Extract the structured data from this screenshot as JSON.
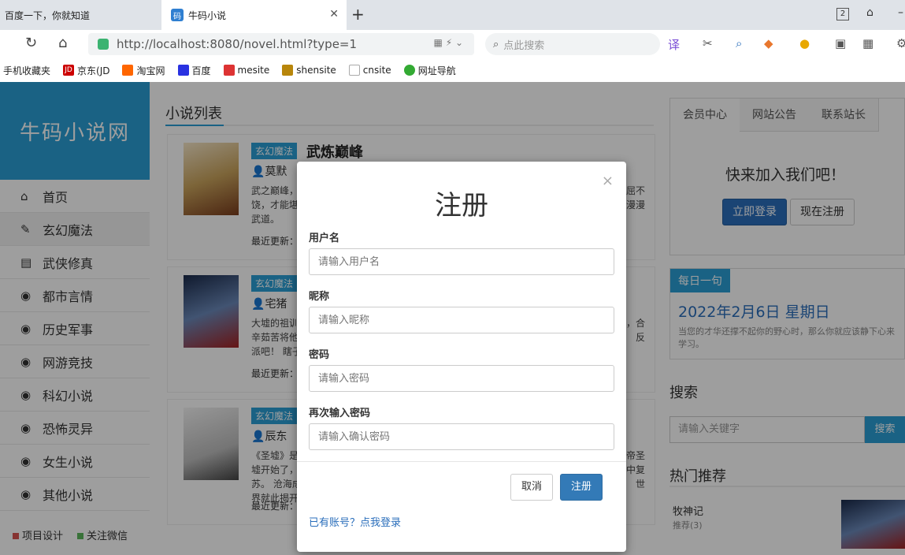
{
  "browser": {
    "tabs": [
      {
        "label": "百度一下，你就知道"
      },
      {
        "label": "牛码小说",
        "favicon": "码"
      }
    ],
    "tab_count": "2",
    "url": "http://localhost:8080/novel.html?type=1",
    "search_placeholder": "点此搜索",
    "bookmarks": [
      {
        "label": "手机收藏夹"
      },
      {
        "label": "京东(JD",
        "icon": "JD"
      },
      {
        "label": "淘宝网"
      },
      {
        "label": "百度"
      },
      {
        "label": "mesite"
      },
      {
        "label": "shensite"
      },
      {
        "label": "cnsite"
      },
      {
        "label": "网址导航"
      }
    ]
  },
  "site": {
    "logo": "牛码小说网",
    "nav": [
      {
        "label": "首页",
        "icon": "home-icon"
      },
      {
        "label": "玄幻魔法",
        "icon": "magic-icon"
      },
      {
        "label": "武侠修真",
        "icon": "book-icon"
      },
      {
        "label": "都市言情",
        "icon": "globe-icon"
      },
      {
        "label": "历史军事",
        "icon": "globe-icon"
      },
      {
        "label": "网游竞技",
        "icon": "globe-icon"
      },
      {
        "label": "科幻小说",
        "icon": "globe-icon"
      },
      {
        "label": "恐怖灵异",
        "icon": "globe-icon"
      },
      {
        "label": "女生小说",
        "icon": "globe-icon"
      },
      {
        "label": "其他小说",
        "icon": "globe-icon"
      }
    ],
    "footer": [
      {
        "label": "项目设计",
        "color": "#d9534f"
      },
      {
        "label": "关注微信",
        "color": "#5cb85c"
      }
    ],
    "list_title": "小说列表",
    "update_label": "最近更新：",
    "novels": [
      {
        "tag": "玄幻魔法",
        "title": "武炼巅峰",
        "author": "莫默",
        "desc": "武之巅峰，",
        "desc2": "屈不",
        "desc3": "饶，才能堪",
        "desc4": "漫漫",
        "desc5": "武道。"
      },
      {
        "tag": "玄幻魔法",
        "title": "",
        "author": "宅猪",
        "desc": "大墟的祖训",
        "desc2": "，合",
        "desc3": "辛茹苦将他",
        "desc4": "反",
        "desc5": "派吧！ 瞎子"
      },
      {
        "tag": "玄幻魔法",
        "title": "",
        "author": "辰东",
        "desc": "《圣墟》是",
        "desc2": "帝圣",
        "desc3": "墟开始了，",
        "desc4": "中复",
        "desc5": "苏。 沧海成",
        "desc6": "世",
        "desc7": "界就此揭开"
      }
    ]
  },
  "right": {
    "tabs": [
      "会员中心",
      "网站公告",
      "联系站长"
    ],
    "join_text": "快来加入我们吧！",
    "login_label": "立即登录",
    "register_label": "现在注册",
    "daily_tag": "每日一句",
    "daily_date": "2022年2月6日 星期日",
    "daily_quote": "当您的才华还撑不起你的野心时，那么你就应该静下心来学习。",
    "search_title": "搜索",
    "search_placeholder": "请输入关键字",
    "search_button": "搜索",
    "hot_title": "热门推荐",
    "hot_name": "牧神记",
    "hot_sub": "推荐(3)"
  },
  "modal": {
    "title": "注册",
    "close": "×",
    "fields": [
      {
        "label": "用户名",
        "placeholder": "请输入用户名"
      },
      {
        "label": "昵称",
        "placeholder": "请输入昵称"
      },
      {
        "label": "密码",
        "placeholder": "请输入密码"
      },
      {
        "label": "再次输入密码",
        "placeholder": "请输入确认密码"
      }
    ],
    "cancel_label": "取消",
    "submit_label": "注册",
    "login_link": "已有账号？点我登录"
  },
  "colors": {
    "brand": "#2a9fd6",
    "primary": "#337ab7"
  }
}
